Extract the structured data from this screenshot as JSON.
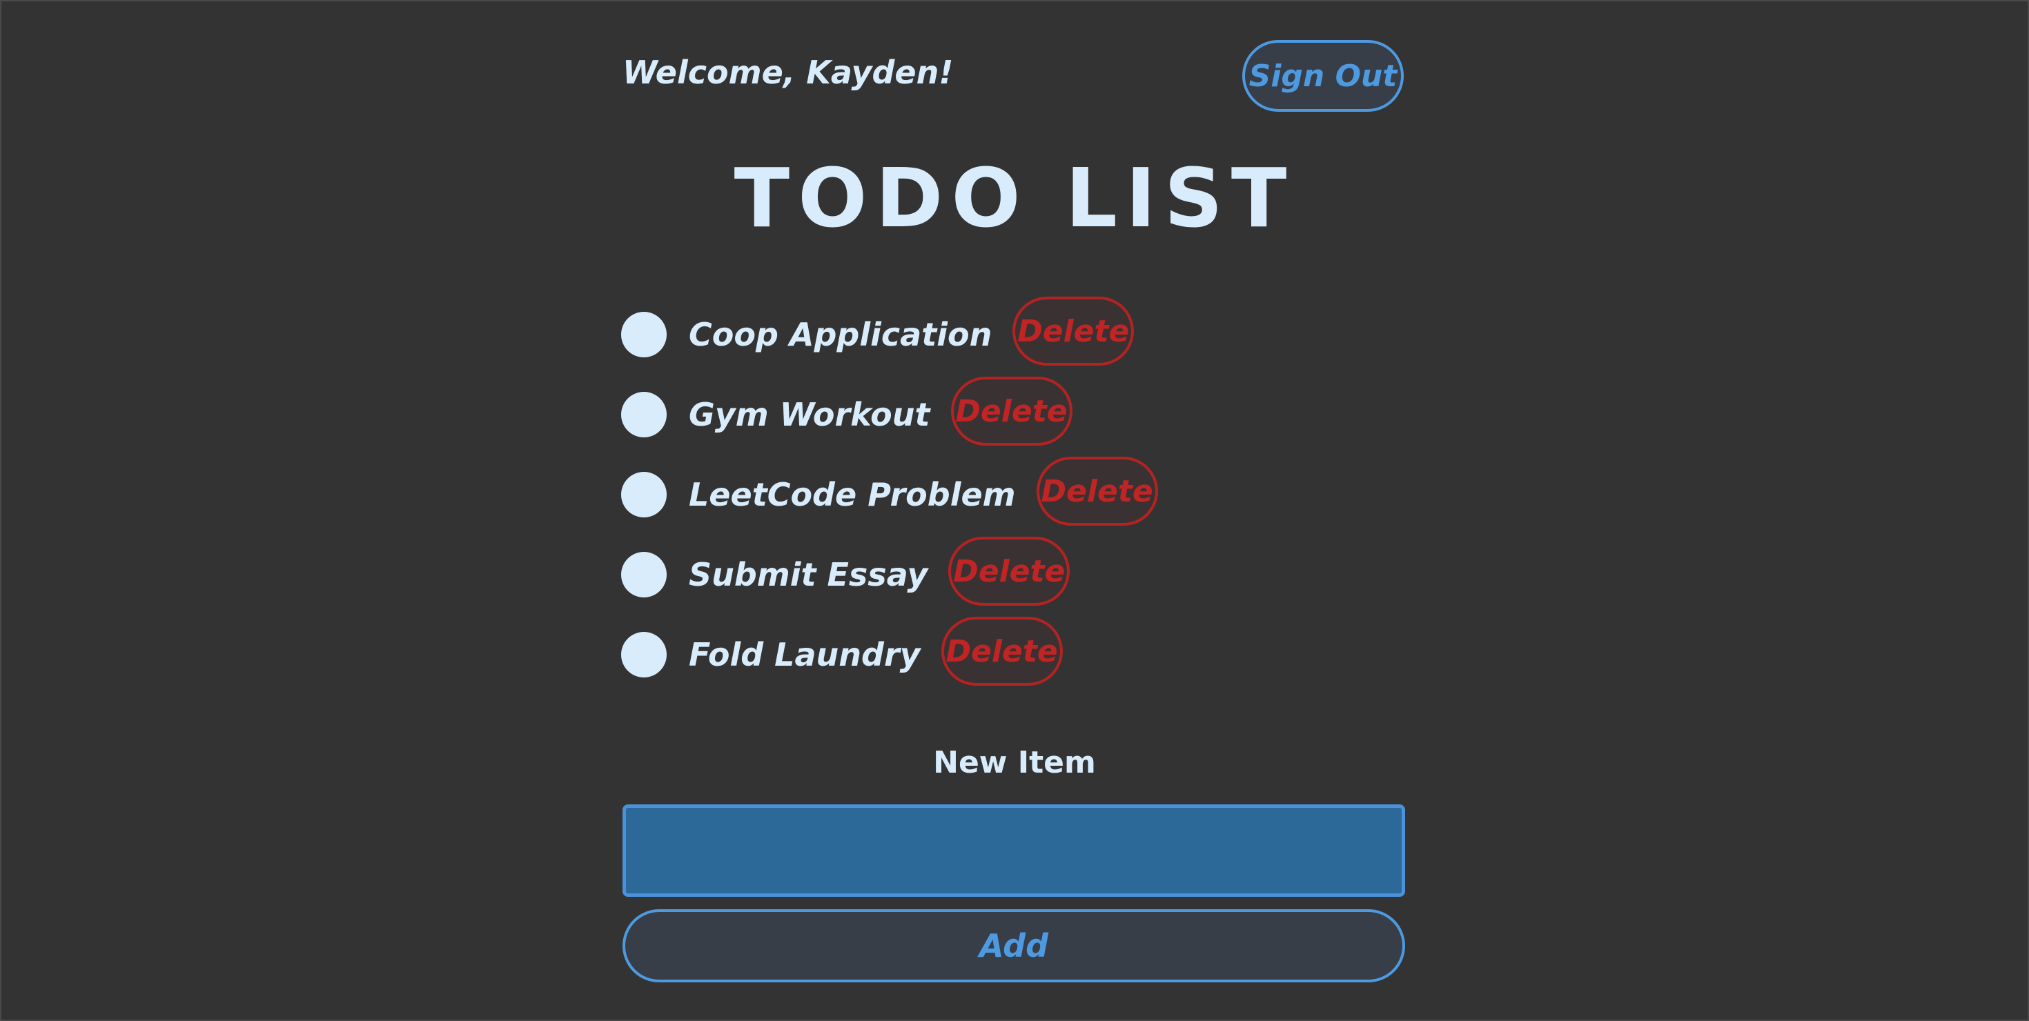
{
  "header": {
    "welcome": "Welcome, Kayden!",
    "sign_out_label": "Sign Out"
  },
  "title": "TODO LIST",
  "todos": [
    {
      "label": "Coop Application",
      "delete_label": "Delete"
    },
    {
      "label": "Gym Workout",
      "delete_label": "Delete"
    },
    {
      "label": "LeetCode Problem",
      "delete_label": "Delete"
    },
    {
      "label": "Submit Essay",
      "delete_label": "Delete"
    },
    {
      "label": "Fold Laundry",
      "delete_label": "Delete"
    }
  ],
  "new_item": {
    "label": "New Item",
    "value": "",
    "add_label": "Add"
  },
  "colors": {
    "background": "#333333",
    "text": "#d8ecfb",
    "accent_blue": "#4d9ae0",
    "input_fill": "#2c6898",
    "delete_red": "#c12424"
  }
}
